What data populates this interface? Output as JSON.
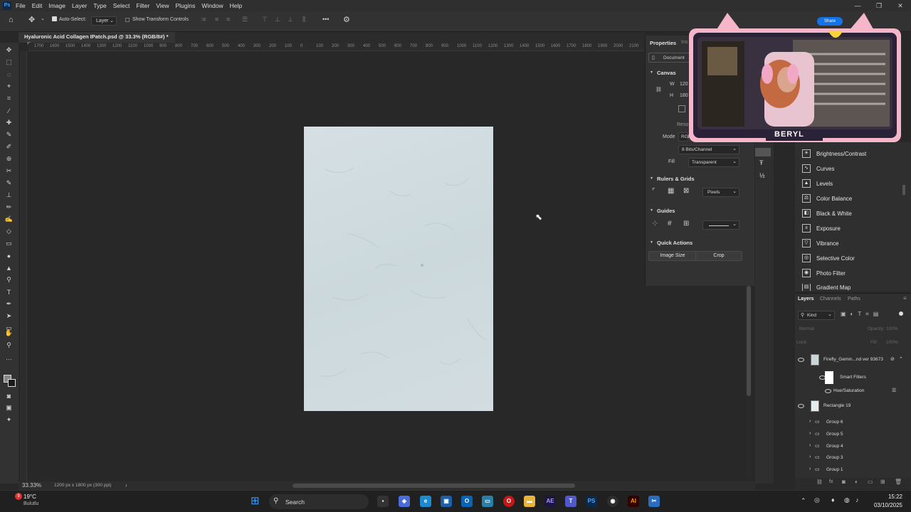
{
  "menubar": {
    "logo": "Ps",
    "items": [
      "File",
      "Edit",
      "Image",
      "Layer",
      "Type",
      "Select",
      "Filter",
      "View",
      "Plugins",
      "Window",
      "Help"
    ]
  },
  "options": {
    "auto_select_label": "Auto-Select:",
    "auto_select_checked": true,
    "target": "Layer",
    "show_transform_label": "Show Transform Controls",
    "show_transform_checked": false,
    "more": "•••"
  },
  "document_tab": {
    "title": "Hyaluronic Acid Collagen IPatch.psd @ 33.3% (RGB/8#) *",
    "close": "×"
  },
  "ruler": {
    "h_labels": [
      "1700",
      "1600",
      "1500",
      "1400",
      "1300",
      "1200",
      "1100",
      "1000",
      "900",
      "800",
      "700",
      "600",
      "500",
      "400",
      "300",
      "200",
      "100",
      "0",
      "100",
      "200",
      "300",
      "400",
      "500",
      "600",
      "700",
      "800",
      "900",
      "1000",
      "1100",
      "1200",
      "1300",
      "1400",
      "1500",
      "1600",
      "1700",
      "1800",
      "1900",
      "2000",
      "2100",
      "2200"
    ]
  },
  "status": {
    "zoom": "33.33%",
    "doc_info": "1200 px x 1800 px (300 ppi)",
    "arrow": "›"
  },
  "properties": {
    "tabs": [
      "Properties",
      "Ins"
    ],
    "document_label": "Document",
    "canvas_header": "Canvas",
    "w_label": "W",
    "w_value": "120",
    "h_label": "H",
    "h_value": "180",
    "res_label": "Reso",
    "mode_label": "Mode",
    "mode_value": "RGB",
    "bits_value": "8 Bits/Channel",
    "fill_label": "Fill",
    "fill_value": "Transparent",
    "rulers_header": "Rulers & Grids",
    "units_value": "Pixels",
    "guides_header": "Guides",
    "quick_header": "Quick Actions",
    "image_size_btn": "Image Size",
    "crop_btn": "Crop"
  },
  "adjustments": {
    "items": [
      "Brightness/Contrast",
      "Curves",
      "Levels",
      "Color Balance",
      "Black & White",
      "Exposure",
      "Vibrance",
      "Selective Color",
      "Photo Filter",
      "Gradient Map"
    ],
    "icons": [
      "brightness-icon",
      "curves-icon",
      "levels-icon",
      "color-balance-icon",
      "black-white-icon",
      "exposure-icon",
      "vibrance-icon",
      "selective-color-icon",
      "photo-filter-icon",
      "gradient-map-icon"
    ]
  },
  "layers_panel": {
    "tabs": [
      "Layers",
      "Channels",
      "Paths"
    ],
    "kind_label": "Kind",
    "blend_mode": "Normal",
    "opacity_label": "Opacity:",
    "opacity_value": "100%",
    "lock_label": "Lock:",
    "fill_label": "Fill:",
    "fill_value": "100%",
    "layers": [
      {
        "name": "Firefly_Gemin...nd ver 93673",
        "visible": true
      },
      {
        "name": "Smart Filters",
        "visible": true
      },
      {
        "name": "Hue/Saturation",
        "visible": true
      },
      {
        "name": "Rectangle 19",
        "visible": true
      },
      {
        "name": "Group 6",
        "visible": false
      },
      {
        "name": "Group 5",
        "visible": false
      },
      {
        "name": "Group 4",
        "visible": false
      },
      {
        "name": "Group 3",
        "visible": false
      },
      {
        "name": "Group 1",
        "visible": false
      }
    ],
    "fx": "fx"
  },
  "webcam": {
    "name": "BERYL",
    "share": "Share"
  },
  "taskbar": {
    "weather_temp": "19°C",
    "weather_desc": "Bulutlu",
    "badge": "9",
    "search_placeholder": "Search",
    "time": "15:22",
    "date": "03/10/2025",
    "apps": [
      "AE",
      "PS",
      "AI"
    ]
  },
  "colors": {
    "accent": "#1473e6",
    "canvas": "#d3dde1",
    "workspace": "#282828",
    "panel": "#323232"
  }
}
